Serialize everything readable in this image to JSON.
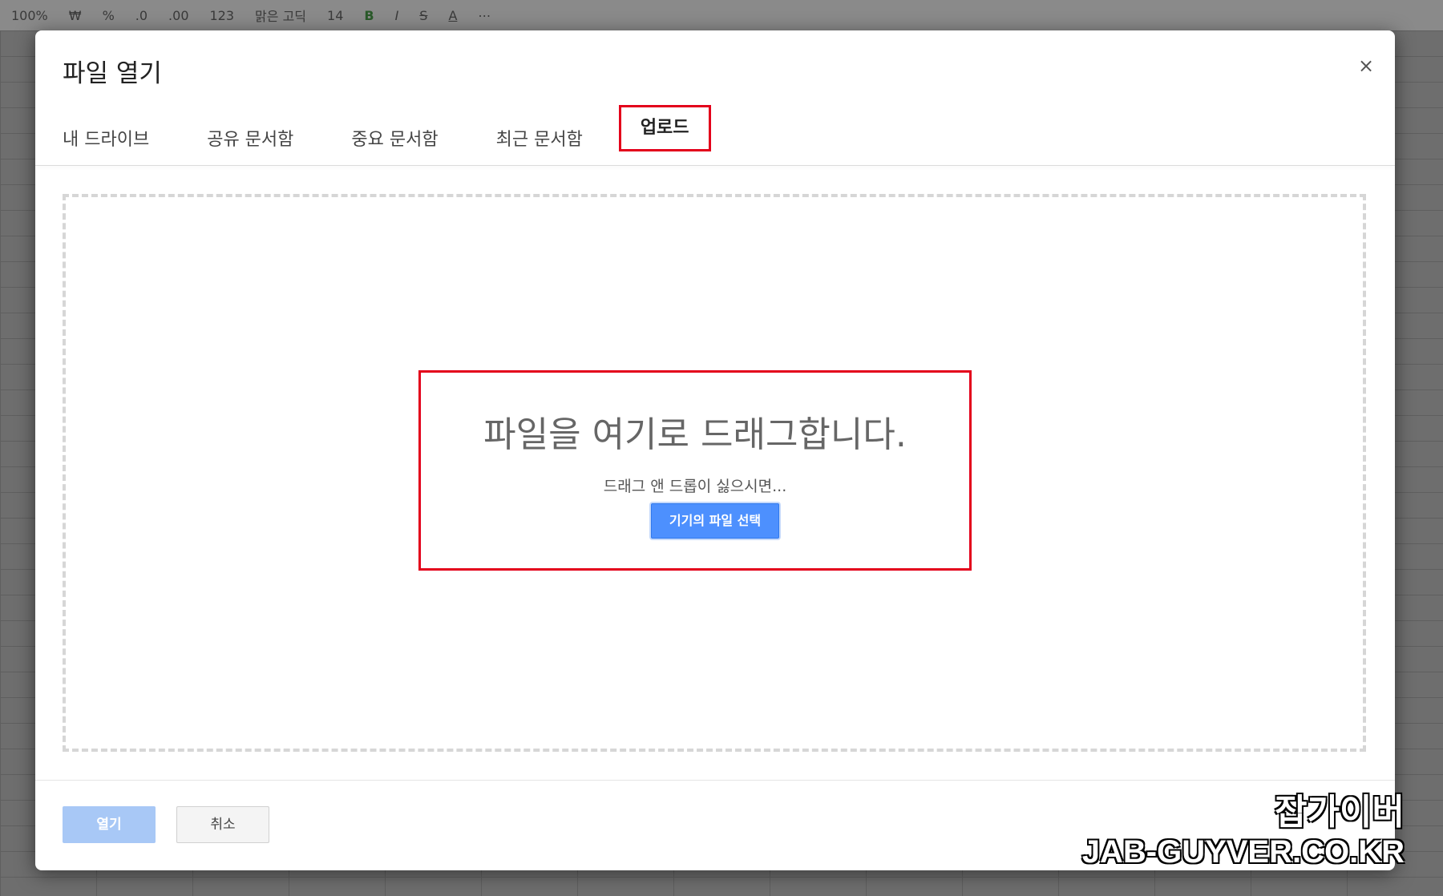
{
  "toolbar": {
    "zoom": "100%",
    "currency": "₩",
    "percent": "%",
    "decimal_dec": ".0",
    "decimal_inc": ".00",
    "format_more": "123",
    "font": "맑은 고딕",
    "font_size": "14",
    "bold": "B",
    "italic": "I",
    "strike": "S",
    "text_color": "A",
    "more": "⋯"
  },
  "dialog": {
    "title": "파일 열기",
    "close_symbol": "×",
    "tabs": [
      {
        "label": "내 드라이브"
      },
      {
        "label": "공유 문서함"
      },
      {
        "label": "중요 문서함"
      },
      {
        "label": "최근 문서함"
      },
      {
        "label": "업로드",
        "active": true
      }
    ],
    "drop_zone": {
      "headline": "파일을 여기로 드래그합니다.",
      "subtext": "드래그 앤 드롭이 싫으시면...",
      "select_button": "기기의 파일 선택"
    },
    "footer": {
      "open_label": "열기",
      "cancel_label": "취소"
    }
  },
  "watermark": {
    "korean": "잡가이버",
    "english": "JAB-GUYVER.CO.KR"
  },
  "colors": {
    "highlight_red": "#e3001b",
    "primary_blue": "#4d90fe",
    "disabled_blue": "#a8c8f6"
  }
}
